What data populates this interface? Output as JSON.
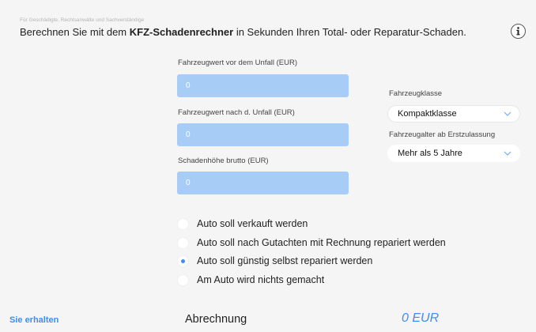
{
  "header": {
    "subtitle": "Für Geschädigte, Rechtsanwälte und Sachverständige",
    "headline_prefix": "Berechnen Sie mit dem ",
    "headline_bold": "KFZ-Schadenrechner",
    "headline_suffix": " in Sekunden Ihren Total- oder Reparatur-Schaden."
  },
  "fields": [
    {
      "label": "Fahrzeugwert vor dem Unfall (EUR)",
      "placeholder": "0",
      "value": ""
    },
    {
      "label": "Fahrzeugwert nach d. Unfall (EUR)",
      "placeholder": "0",
      "value": ""
    },
    {
      "label": "Schadenhöhe brutto (EUR)",
      "placeholder": "0",
      "value": ""
    }
  ],
  "vehicle_class": {
    "label": "Fahrzeugklasse",
    "selected": "Kompaktklasse"
  },
  "vehicle_age": {
    "label": "Fahrzeugalter ab Erstzulassung",
    "selected": "Mehr als 5 Jahre"
  },
  "options": [
    {
      "label": "Auto soll verkauft werden",
      "selected": false
    },
    {
      "label": "Auto soll nach Gutachten mit Rechnung repariert werden",
      "selected": false
    },
    {
      "label": "Auto soll günstig selbst repariert werden",
      "selected": true
    },
    {
      "label": "Am Auto wird nichts gemacht",
      "selected": false
    }
  ],
  "result": {
    "section_label": "Sie erhalten",
    "item_label": "Abrechnung",
    "amount": "0 EUR"
  },
  "colors": {
    "accent": "#3d8ef0",
    "input_fill": "#a7cdf6",
    "background": "#f5f5f5"
  },
  "icons": {
    "info": "info-icon",
    "dropdown": "chevron-down-icon"
  }
}
